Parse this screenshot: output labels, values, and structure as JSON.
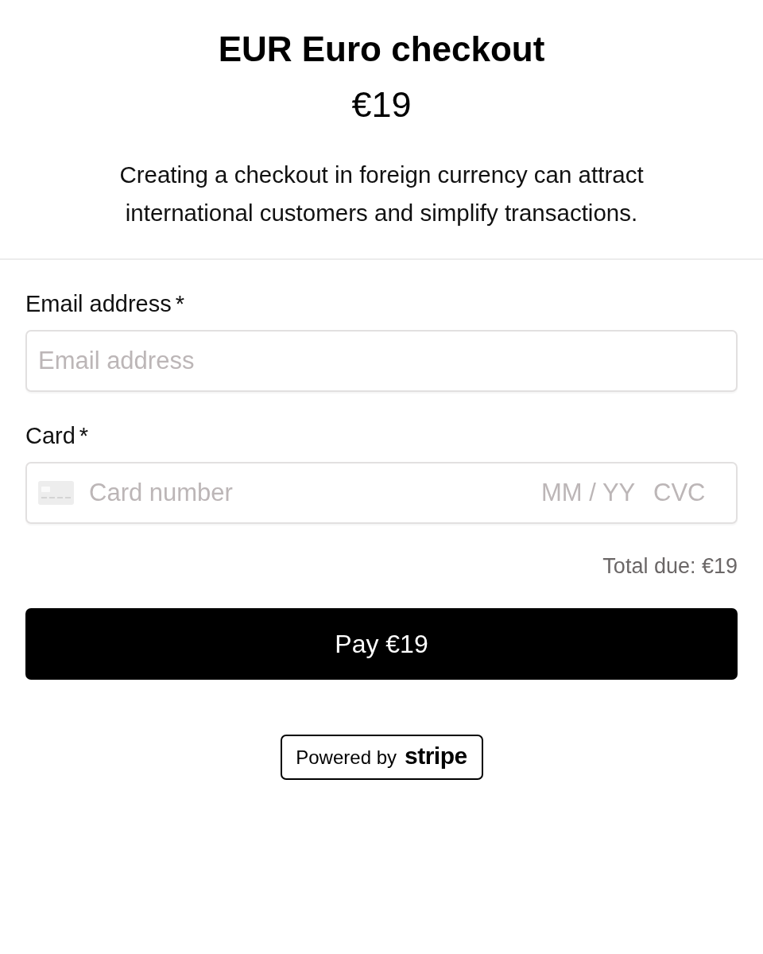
{
  "header": {
    "title": "EUR Euro checkout",
    "price": "€19",
    "description": "Creating a checkout in foreign currency can attract international customers and simplify transactions."
  },
  "form": {
    "fields": [
      {
        "kind": "email",
        "label": "Email address",
        "required_mark": "*",
        "placeholder": "Email address"
      },
      {
        "kind": "card",
        "label": "Card",
        "required_mark": "*",
        "placeholder": "Card number",
        "expiry_placeholder": "MM / YY",
        "cvc_placeholder": "CVC"
      }
    ],
    "total": "Total due: €19",
    "pay_button": "Pay €19"
  },
  "footer": {
    "powered_by": "Powered by",
    "brand": "stripe"
  }
}
